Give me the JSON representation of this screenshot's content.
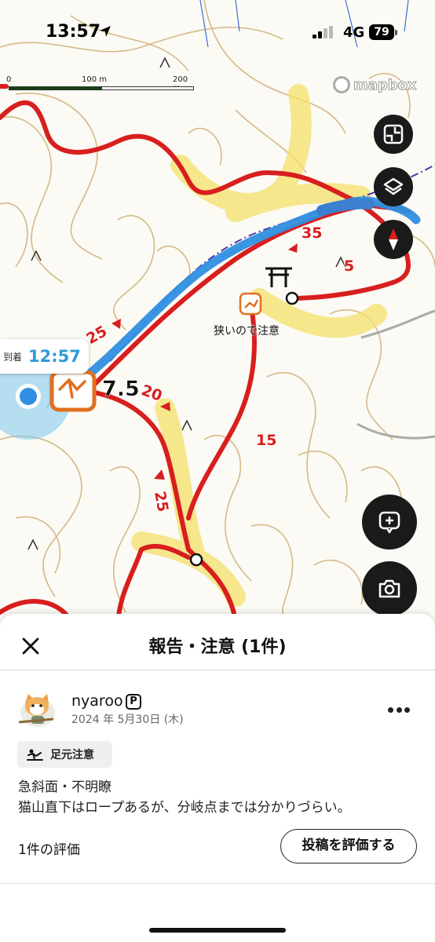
{
  "status_bar": {
    "time": "13:57",
    "network": "4G",
    "battery": "79"
  },
  "map": {
    "scale_labels": [
      "0",
      "100 m",
      "200 m"
    ],
    "attribution": "mapbox",
    "arrival_label": "到着",
    "arrival_time": "12:57",
    "distance_label": "7.5",
    "note_label": "狭いので注意",
    "grade_labels": [
      "35",
      "5",
      "25",
      "20",
      "25",
      "15"
    ],
    "colors": {
      "trail_red": "#d81e1e",
      "route_blue": "#2f8fe0",
      "highlight_yellow": "#f5e06a",
      "contour_brown": "#c9a46a"
    }
  },
  "controls": {
    "fullscreen_icon": "shrink-icon",
    "layers_icon": "layers-icon",
    "compass_icon": "compass-icon",
    "add_post_icon": "add-comment-icon",
    "camera_icon": "camera-icon"
  },
  "sheet": {
    "title": "報告・注意 (1件)",
    "post": {
      "username": "nyaroo",
      "badge": "P",
      "date": "2024 年 5月30日 (木)",
      "tag": "足元注意",
      "body_lines": [
        "急斜面・不明瞭",
        "猫山直下はロープあるが、分岐点までは分かりづらい。"
      ]
    },
    "rating_count": "1件の評価",
    "rate_button": "投稿を評価する"
  }
}
